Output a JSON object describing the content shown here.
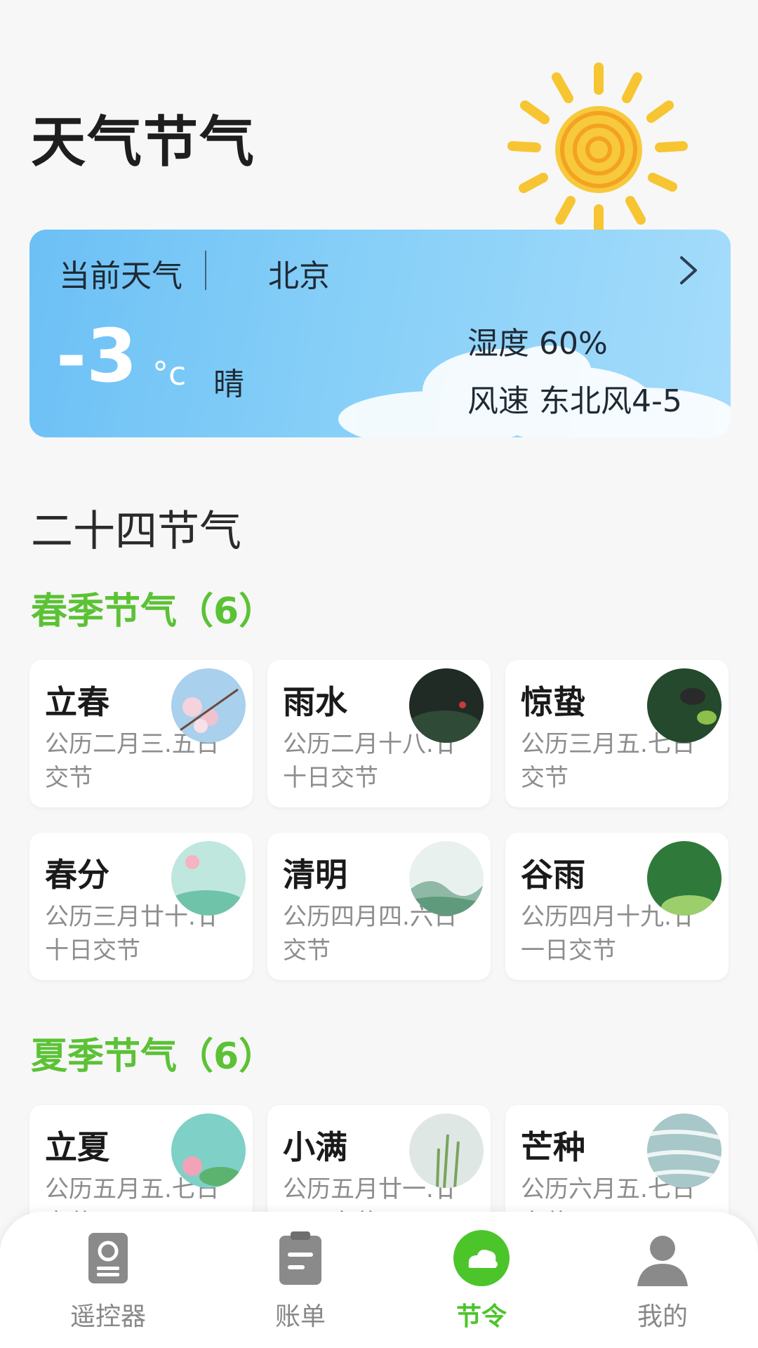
{
  "header": {
    "title": "天气节气"
  },
  "weather": {
    "label": "当前天气",
    "city": "北京",
    "temperature": "-3",
    "unit": "°c",
    "condition": "晴",
    "humidity": "湿度 60%",
    "wind": "风速 东北风4-5"
  },
  "section_title": "二十四节气",
  "seasons": [
    {
      "title": "春季节气（6）",
      "terms": [
        {
          "name": "立春",
          "date": "公历二月三.五日交节"
        },
        {
          "name": "雨水",
          "date": "公历二月十八.廿十日交节"
        },
        {
          "name": "惊蛰",
          "date": "公历三月五.七日交节"
        },
        {
          "name": "春分",
          "date": "公历三月廿十.廿十日交节"
        },
        {
          "name": "清明",
          "date": "公历四月四.六日交节"
        },
        {
          "name": "谷雨",
          "date": "公历四月十九.廿一日交节"
        }
      ]
    },
    {
      "title": "夏季节气（6）",
      "terms": [
        {
          "name": "立夏",
          "date": "公历五月五.七日交节"
        },
        {
          "name": "小满",
          "date": "公历五月廿一.廿二日交节"
        },
        {
          "name": "芒种",
          "date": "公历六月五.七日交节"
        }
      ]
    }
  ],
  "tabs": [
    {
      "label": "遥控器",
      "icon": "remote-icon"
    },
    {
      "label": "账单",
      "icon": "bill-icon"
    },
    {
      "label": "节令",
      "icon": "cloud-icon"
    },
    {
      "label": "我的",
      "icon": "user-icon"
    }
  ],
  "colors": {
    "accent": "#4cc52b",
    "season": "#5bc235"
  }
}
